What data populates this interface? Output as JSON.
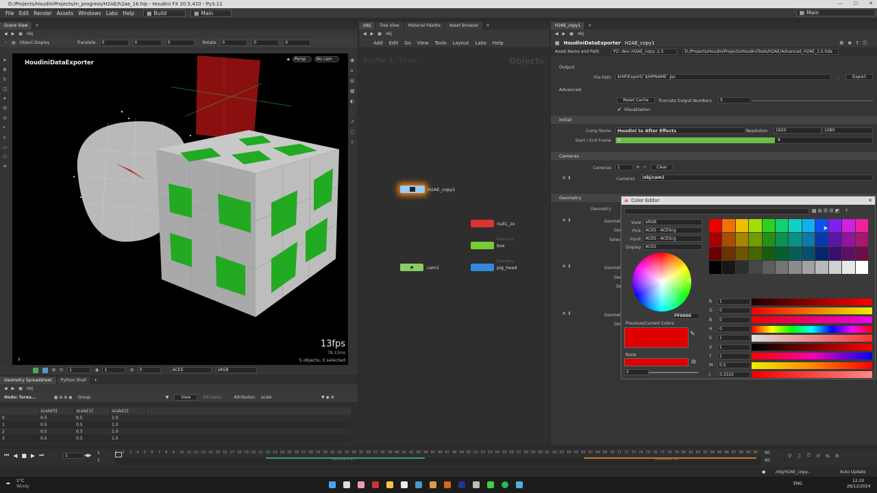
{
  "title_path": "D:/Projects/HoudiniProjects/in_progress/H2AE/h2ae_16.hip - Houdini FX 20.5.410 - Py3.11",
  "menu": [
    "File",
    "Edit",
    "Render",
    "Assets",
    "Windows",
    "Labs",
    "Help"
  ],
  "desktop_left": "Build",
  "desktop_center": "Main",
  "desktop_right": "Main",
  "scene_view": {
    "tabs": [
      "Scene View"
    ],
    "path": "obj",
    "object_display": "Object Display",
    "translate_label": "Translate",
    "translate": [
      "0",
      "0",
      "0"
    ],
    "rotate_label": "Rotate",
    "rotate": [
      "0",
      "0",
      "0"
    ],
    "overlay_title": "HoudiniDataExporter",
    "persp": "Persp",
    "nocam": "No cam",
    "fps": "13fps",
    "ms": "78.12ms",
    "objects": "5 objects, 0 selected",
    "bottom_vals": [
      "1",
      "1",
      "0"
    ],
    "aces": "ACES",
    "srgb": "sRGB"
  },
  "network": {
    "tabs": [
      "/obj",
      "Tree View",
      "Material Palette",
      "Asset Browser"
    ],
    "path": "obj",
    "menu": [
      "Add",
      "Edit",
      "Go",
      "View",
      "Tools",
      "Layout",
      "Labs",
      "Help"
    ],
    "profile": "Profile 1: Time",
    "objects_label": "Objects",
    "nodes": {
      "h2ae": "H2AE_copy1",
      "null": "null1_zx",
      "box": "box",
      "cam": "cam1",
      "pig": "pig_head",
      "geo_tag": "Geometry"
    }
  },
  "params": {
    "tab": "H2AE_copy1",
    "path": "obj",
    "node_type": "HoudiniDataExporter",
    "node_name": "H2AE_copy1",
    "asset_name_label": "Asset Name and Path",
    "asset_name": "PZ::dev::H2AE_copy::1.5",
    "asset_path": "D:/Projects/HoudiniProjects/HoudiniTools/H2AE/Advanced_H2AE_1.5.hda",
    "output": "Output",
    "file_path_label": "File Path",
    "file_path": "$HIP/Export/`$HIPNAME`.jsx",
    "export": "Export",
    "advanced": "Advanced",
    "reset_cache": "Reset Cache",
    "truncate_label": "Truncate Output Numbers",
    "truncate": "5",
    "visualization": "Visualization",
    "initial": "Initial",
    "comp_name_label": "Comp Name",
    "comp_name": "Houdini to After Effects",
    "resolution_label": "Resolution",
    "res_w": "1920",
    "res_h": "1080",
    "frame_label": "Start / End Frame",
    "frame_start": "1",
    "frame_end": "4",
    "frame_fill": 0.62,
    "cameras_hdr": "Cameras",
    "cameras_label": "Cameras",
    "cameras": "1",
    "clear": "Clear",
    "camera1_label": "Camera1",
    "camera1": "/obj/cam1",
    "geometry_hdr": "Geometry",
    "geometry_label": "Geometry",
    "geo_rows": [
      "Geometr",
      "Geo",
      "Select",
      "Geometr",
      "Geo",
      "Sel",
      "Geometr",
      "Geo"
    ]
  },
  "color_editor": {
    "title": "Color Editor",
    "view_label": "View:",
    "view": "sRGB",
    "pick_label": "Pick:",
    "pick": "ACES - ACEScg",
    "input_label": "Input:",
    "input": "ACES - ACEScg",
    "display_label": "Display:",
    "display": "ACES",
    "hex": "FF0000",
    "prev_current": "Previous/Current Colors",
    "none": "None",
    "alpha": "0",
    "channels": [
      {
        "k": "R",
        "v": "1"
      },
      {
        "k": "G",
        "v": "0"
      },
      {
        "k": "B",
        "v": "0"
      },
      {
        "k": "H",
        "v": "0"
      },
      {
        "k": "S",
        "v": "1"
      },
      {
        "k": "V",
        "v": "1"
      },
      {
        "k": "T",
        "v": "1"
      },
      {
        "k": "M",
        "v": "0.5"
      },
      {
        "k": "I",
        "v": "0.3333"
      }
    ],
    "palette": [
      "#ee0000",
      "#f07000",
      "#f0c000",
      "#a0e000",
      "#30d020",
      "#10d070",
      "#10d0c0",
      "#10b0f0",
      "#1050f0",
      "#8020f0",
      "#d020e0",
      "#f020a0"
    ],
    "current_color": "#e00000"
  },
  "spreadsheet": {
    "tabs": [
      "Geometry Spreadsheet",
      "Python Shell"
    ],
    "path": "obj",
    "node_label": "Node: forea...",
    "group_label": "Group:",
    "view": "View",
    "intrinsics": "Intrinsics",
    "attributes_label": "Attributes:",
    "attributes": "scale",
    "columns": [
      "",
      "scale[0]",
      "scale[1]",
      "scale[2]"
    ],
    "rows": [
      [
        "0",
        "0.5",
        "0.5",
        "1.0"
      ],
      [
        "1",
        "0.5",
        "0.5",
        "1.0"
      ],
      [
        "2",
        "0.5",
        "0.5",
        "1.0"
      ],
      [
        "3",
        "0.5",
        "0.5",
        "1.0"
      ]
    ]
  },
  "timeline": {
    "frame": "1",
    "start": "1",
    "end": "1",
    "ticks": [
      "1",
      "2",
      "3",
      "4",
      "5",
      "6",
      "7",
      "8",
      "9",
      "10",
      "11",
      "12",
      "13",
      "14",
      "15",
      "16",
      "17",
      "18",
      "19",
      "20",
      "21",
      "22",
      "23",
      "24",
      "25",
      "26",
      "27",
      "28",
      "29",
      "30",
      "31",
      "32",
      "33",
      "34",
      "35",
      "36",
      "37",
      "38",
      "39",
      "40",
      "41",
      "42",
      "43",
      "44",
      "45",
      "46",
      "47",
      "48",
      "49",
      "50",
      "51",
      "52",
      "53",
      "54",
      "55",
      "56",
      "57",
      "58",
      "59",
      "60",
      "61",
      "62",
      "63",
      "64",
      "65",
      "66",
      "67",
      "68",
      "69",
      "70",
      "71",
      "72",
      "73",
      "74",
      "75",
      "76",
      "77",
      "78",
      "79",
      "80",
      "81",
      "82",
      "83",
      "84",
      "85",
      "86",
      "87",
      "88",
      "89",
      "90"
    ],
    "bookmark1": "Bookmark #1",
    "bookmark2": "Bookmark #2",
    "end_vals": [
      "90",
      "90"
    ],
    "status_path": "/obj/H2AE_copy...",
    "auto_update": "Auto Update"
  },
  "taskbar": {
    "weather_temp": "1°C",
    "weather_text": "Windy",
    "lang": "ENG",
    "time": "12:20",
    "date": "26/12/2024"
  }
}
